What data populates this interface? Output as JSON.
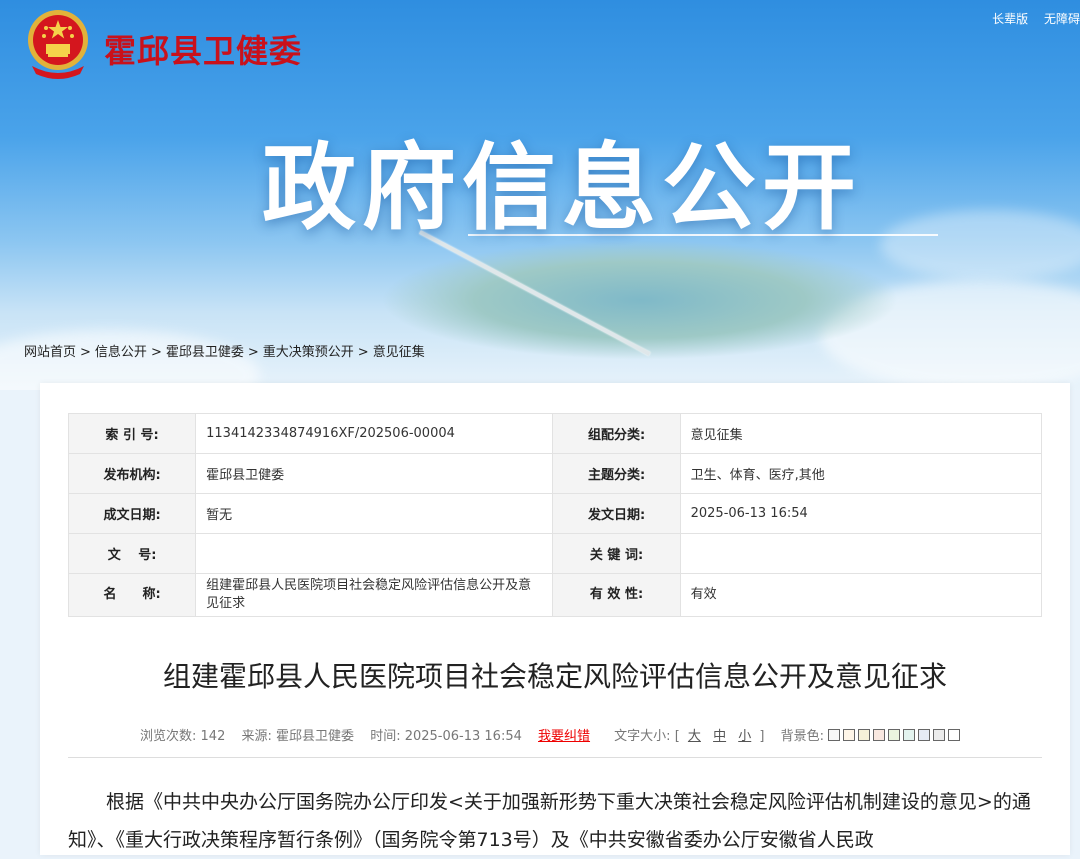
{
  "header": {
    "site_title": "霍邱县卫健委",
    "hero_title": "政府信息公开",
    "links": [
      "长辈版",
      "无障碍"
    ]
  },
  "breadcrumb": [
    "网站首页",
    "信息公开",
    "霍邱县卫健委",
    "重大决策预公开",
    "意见征集"
  ],
  "meta_table": {
    "rows": [
      {
        "k1": "索 引 号:",
        "v1": "1134142334874916XF/202506-00004",
        "k2": "组配分类:",
        "v2": "意见征集"
      },
      {
        "k1": "发布机构:",
        "v1": "霍邱县卫健委",
        "k2": "主题分类:",
        "v2": "卫生、体育、医疗,其他"
      },
      {
        "k1": "成文日期:",
        "v1": "暂无",
        "k2": "发文日期:",
        "v2": "2025-06-13 16:54"
      },
      {
        "k1": "文　 号:",
        "v1": "",
        "k2": "关 键 词:",
        "v2": ""
      },
      {
        "k1": "名　　称:",
        "v1": "组建霍邱县人民医院项目社会稳定风险评估信息公开及意见征求",
        "k2": "有 效 性:",
        "v2": "有效"
      }
    ]
  },
  "article": {
    "title": "组建霍邱县人民医院项目社会稳定风险评估信息公开及意见征求",
    "views_label": "浏览次数:",
    "views": "142",
    "source_label": "来源:",
    "source": "霍邱县卫健委",
    "time_label": "时间:",
    "time": "2025-06-13 16:54",
    "error_link": "我要纠错",
    "font_size_label": "文字大小:",
    "font_sizes": [
      "大",
      "中",
      "小"
    ],
    "bg_label": "背景色:",
    "bg_colors": [
      "#f7f7f7",
      "#fff6e8",
      "#f6f1d9",
      "#f9e8e0",
      "#eaf4df",
      "#e3f3ef",
      "#e6ebf5",
      "#ececec",
      "#ffffff"
    ],
    "body_text": "根据《中共中央办公厅国务院办公厅印发<关于加强新形势下重大决策社会稳定风险评估机制建设的意见>的通知》、《重大行政决策程序暂行条例》（国务院令第713号）及《中共安徽省委办公厅安徽省人民政"
  }
}
